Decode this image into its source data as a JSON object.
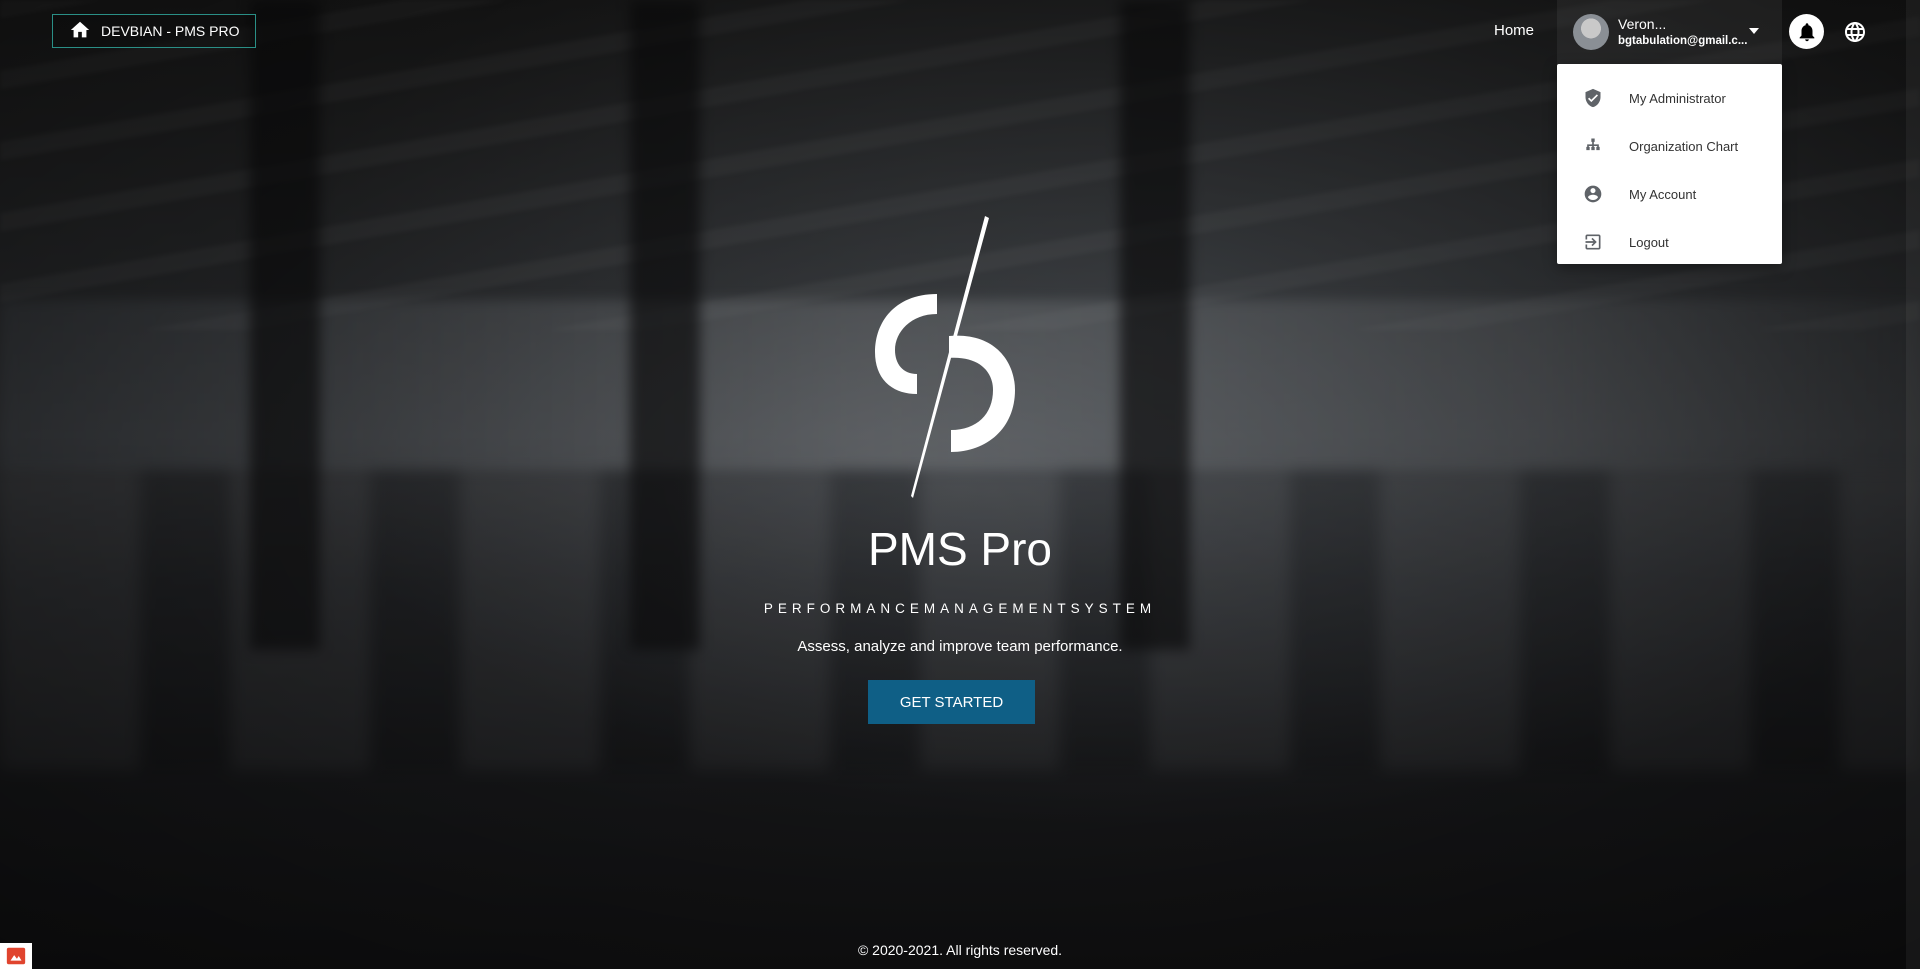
{
  "brand": {
    "label": "DEVBIAN - PMS PRO",
    "icon": "home-icon"
  },
  "nav": {
    "home": "Home"
  },
  "user": {
    "name": "Veron...",
    "email": "bgtabulation@gmail.c..."
  },
  "menu": {
    "items": [
      {
        "label": "My Administrator",
        "icon": "shield-check-icon"
      },
      {
        "label": "Organization Chart",
        "icon": "org-chart-icon"
      },
      {
        "label": "My Account",
        "icon": "account-circle-icon"
      },
      {
        "label": "Logout",
        "icon": "logout-icon"
      }
    ]
  },
  "hero": {
    "title": "PMS Pro",
    "subtitle": "PERFORMANCEMANAGEMENTSYSTEM",
    "tagline": "Assess, analyze and improve team performance.",
    "cta": "GET STARTED"
  },
  "footer": {
    "copyright": "© 2020-2021. All rights reserved."
  },
  "colors": {
    "accent": "#0f5f86",
    "brand_border": "#2a8f86"
  }
}
